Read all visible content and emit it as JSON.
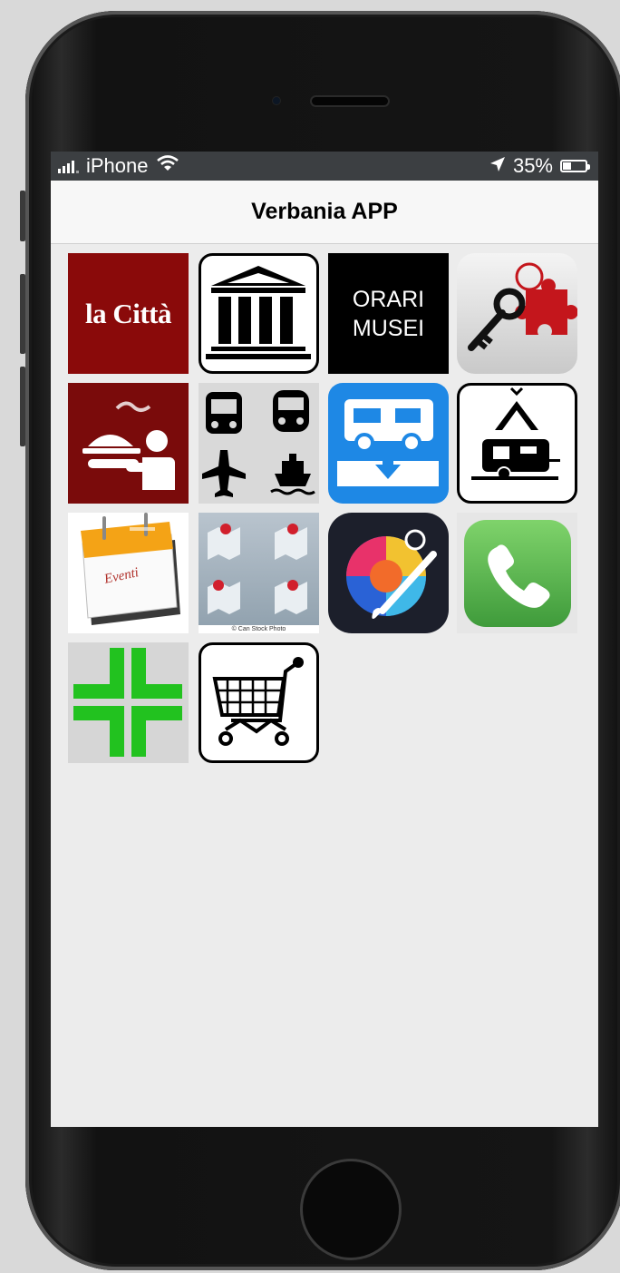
{
  "status_bar": {
    "carrier": "iPhone",
    "battery": "35%"
  },
  "nav": {
    "title": "Verbania APP"
  },
  "tiles": {
    "la_citta": {
      "text": "la Città"
    },
    "monumenti": {},
    "orari_musei": {
      "line1": "ORARI",
      "line2": "MUSEI"
    },
    "chiavi": {},
    "ristoranti": {},
    "trasporti": {},
    "camper": {},
    "campeggi": {},
    "eventi": {
      "text": "Eventi"
    },
    "mappe": {
      "caption": "© Can Stock Photo"
    },
    "arte": {},
    "telefono": {},
    "farmacia": {},
    "shopping": {}
  },
  "colors": {
    "screen_bg": "#ececec",
    "status_bar_bg": "#3c3f42",
    "la_citta_red": "#8a0a0a",
    "camper_blue": "#1e88e5",
    "pharmacy_green": "#2bd02b",
    "phone_green": "#5cb85c"
  }
}
